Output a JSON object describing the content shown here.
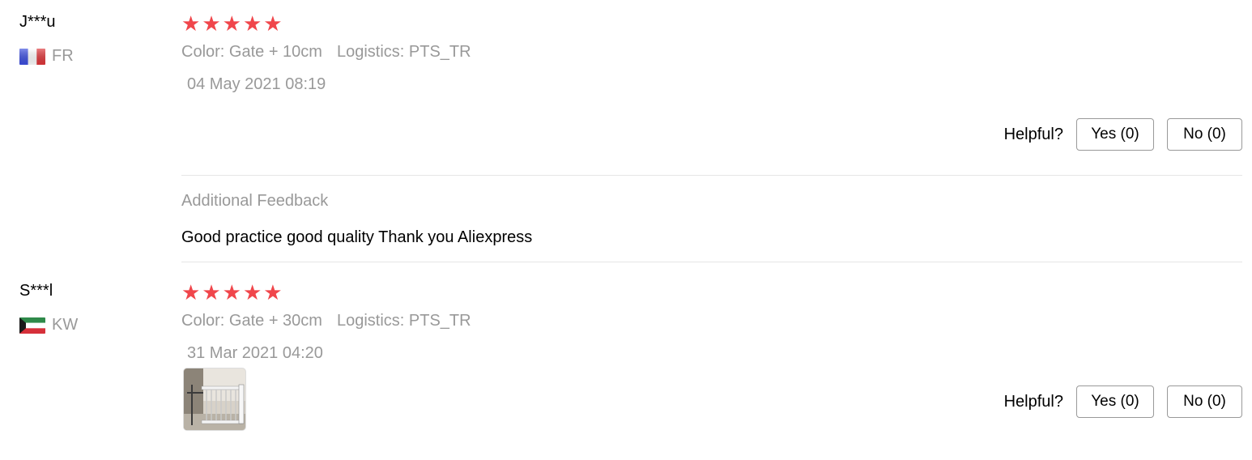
{
  "reviews": [
    {
      "user": "J***u",
      "country_code": "FR",
      "rating": 5,
      "color": "Color: Gate + 10cm",
      "logistics": "Logistics: PTS_TR",
      "date": "04 May 2021 08:19",
      "helpful_label": "Helpful?",
      "yes_label": "Yes (0)",
      "no_label": "No (0)",
      "additional_title": "Additional Feedback",
      "additional_text": "Good practice good quality Thank you Aliexpress"
    },
    {
      "user": "S***l",
      "country_code": "KW",
      "rating": 5,
      "color": "Color: Gate + 30cm",
      "logistics": "Logistics: PTS_TR",
      "date": "31 Mar 2021 04:20",
      "helpful_label": "Helpful?",
      "yes_label": "Yes (0)",
      "no_label": "No (0)"
    }
  ],
  "colors": {
    "star": "#f0464b",
    "muted_text": "#999999",
    "divider": "#e6e6e6"
  },
  "icons": {
    "star": "star-icon",
    "flag_fr": "flag-fr-icon",
    "flag_kw": "flag-kw-icon"
  }
}
